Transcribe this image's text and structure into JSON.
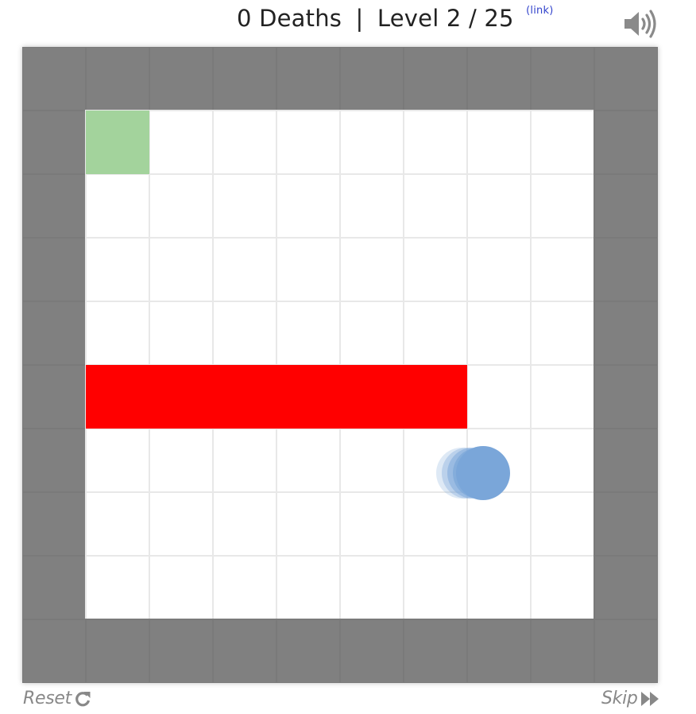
{
  "header": {
    "deaths_count": "0",
    "deaths_label": "Deaths",
    "separator": "|",
    "level_label": "Level",
    "level_current": "2",
    "level_divider": "/",
    "level_total": "25",
    "link_text": "(link)"
  },
  "icons": {
    "sound": "speaker-volume-icon",
    "reset": "refresh-icon",
    "skip": "fast-forward-icon"
  },
  "controls": {
    "reset_label": "Reset",
    "skip_label": "Skip"
  },
  "board": {
    "columns": 10,
    "rows": 10,
    "colors": {
      "wall": "#808080",
      "wall_grid": "#7a7a7a",
      "floor": "#ffffff",
      "floor_grid": "#e8e8e8",
      "goal": "#a3d39c",
      "hazard": "#ff0000",
      "player": "#7aa6d9"
    },
    "goal_cell": {
      "col": 1,
      "row": 1
    },
    "hazard_bar": {
      "row": 5,
      "col_start": 1,
      "col_end": 6
    },
    "player": {
      "col": 7.25,
      "row": 6.7,
      "direction": "right"
    }
  }
}
